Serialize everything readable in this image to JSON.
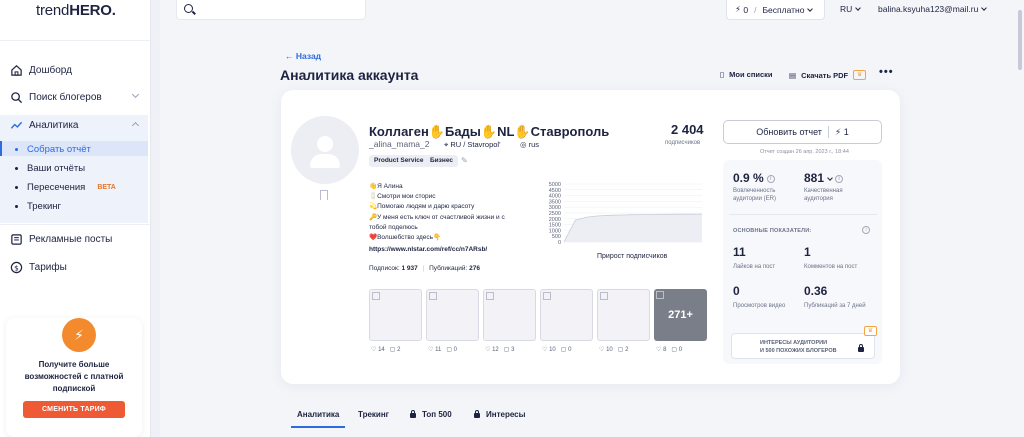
{
  "app": {
    "logo_light": "trend",
    "logo_bold": "HERO."
  },
  "sidebar": {
    "items": [
      {
        "label": "Дошборд"
      },
      {
        "label": "Поиск блогеров"
      },
      {
        "label": "Аналитика"
      }
    ],
    "analytics_sub": [
      {
        "label": "Собрать отчёт"
      },
      {
        "label": "Ваши отчёты"
      },
      {
        "label": "Пересечения",
        "badge": "BETA"
      },
      {
        "label": "Трекинг"
      }
    ],
    "items_bottom": [
      {
        "label": "Рекламные посты"
      },
      {
        "label": "Тарифы"
      }
    ],
    "promo": {
      "text": "Получите больше возможностей с платной подпиской",
      "button": "СМЕНИТЬ ТАРИФ"
    }
  },
  "topbar": {
    "balance": "0",
    "plan": "Бесплатно",
    "language": "RU",
    "email": "balina.ksyuha123@mail.ru"
  },
  "header": {
    "back": "Назад",
    "title": "Аналитика аккаунта",
    "my_lists": "Мои списки",
    "download_pdf": "Скачать PDF",
    "more": "•••"
  },
  "account": {
    "name": "Коллаген✋Бады✋NL✋Ставрополь",
    "handle": "_alina_mama_2",
    "location": "RU / Stavropol'",
    "language": "rus",
    "tags": [
      "Product Service",
      "Бизнес"
    ],
    "followers": "2 404",
    "followers_label": "подписчиков",
    "bio_lines": [
      "👋Я Алина",
      "🥛Смотри мои сторис",
      "💫Помогаю людям и дарю красоту",
      "🔑У меня есть ключ от счастливой жизни и с",
      "тобой поделюсь",
      "❤️Волшебство здесь👇"
    ],
    "link": "https://www.nlstar.com/ref/cc/n7ARsb/",
    "following_label": "Подписок:",
    "following": "1 937",
    "posts_label": "Публикаций:",
    "posts": "276"
  },
  "chart_data": {
    "type": "area",
    "title": "Прирост подписчиков",
    "yticks": [
      "5000",
      "4500",
      "4000",
      "3500",
      "3000",
      "2500",
      "2000",
      "1500",
      "1000",
      "500",
      "0"
    ],
    "ylim": [
      0,
      5000
    ],
    "series": [
      {
        "values": [
          0,
          1900,
          2150,
          2250,
          2300,
          2330,
          2350,
          2370,
          2380,
          2390,
          2395,
          2400,
          2404
        ]
      }
    ]
  },
  "posts": [
    {
      "likes": "14",
      "comments": "2"
    },
    {
      "likes": "11",
      "comments": "0"
    },
    {
      "likes": "12",
      "comments": "3"
    },
    {
      "likes": "10",
      "comments": "0"
    },
    {
      "likes": "10",
      "comments": "2"
    },
    {
      "likes": "8",
      "comments": "0",
      "more": "271+"
    }
  ],
  "metrics": {
    "update_button": "Обновить отчет",
    "update_cost": "1",
    "report_date": "Отчет создан 26 апр. 2023 г., 18:44",
    "er_value": "0.9 %",
    "er_label_1": "Вовлеченность",
    "er_label_2": "аудитории (ER)",
    "quality_value": "881",
    "quality_label_1": "Качественная",
    "quality_label_2": "аудитория",
    "section_title": "ОСНОВНЫЕ ПОКАЗАТЕЛИ:",
    "likes_value": "11",
    "likes_label": "Лайков на пост",
    "comments_value": "1",
    "comments_label": "Комментов на пост",
    "views_value": "0",
    "views_label": "Просмотров видео",
    "weekly_value": "0.36",
    "weekly_label": "Публикаций за 7 дней",
    "interests_line1": "ИНТЕРЕСЫ АУДИТОРИИ",
    "interests_line2": "И 500 ПОХОЖИХ БЛОГЕРОВ"
  },
  "tabs": [
    {
      "label": "Аналитика"
    },
    {
      "label": "Трекинг"
    },
    {
      "label": "Топ 500"
    },
    {
      "label": "Интересы"
    }
  ],
  "colors": {
    "accent": "#2d6cdf",
    "promo": "#ee5a33",
    "beta": "#e8762c"
  }
}
